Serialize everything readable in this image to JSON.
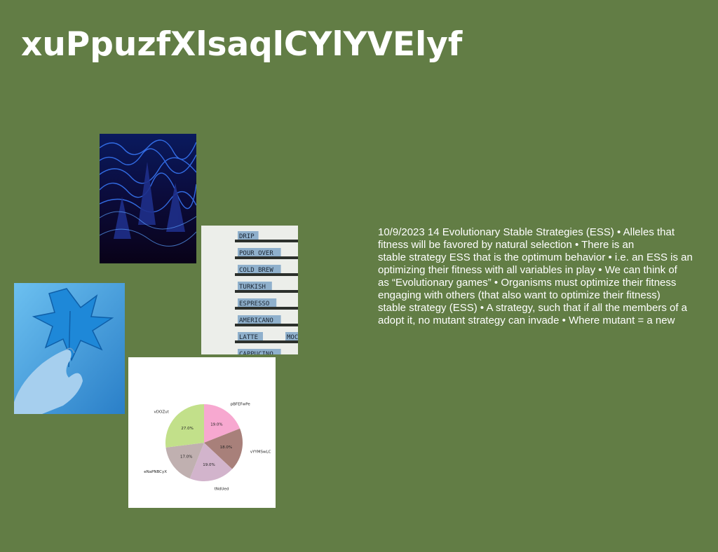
{
  "slide": {
    "title": "xuPpuzfXlsaqlCYlYVElyf",
    "background_color": "#627d45",
    "body_lines": [
      "10/9/2023 14 Evolutionary Stable Strategies (ESS) • Alleles that",
      "fitness will be favored by natural selection • There is an",
      "stable strategy ESS that is the optimum behavior • i.e. an ESS is an",
      "optimizing their fitness with all variables in play • We can think of",
      "as “Evolutionary games” • Organisms must optimize their fitness",
      "engaging with others (that also want to optimize their fitness)",
      "stable strategy (ESS) • A strategy, such that if all the members of a",
      "adopt it, no mutant strategy can invade • Where mutant =  a new"
    ]
  },
  "images": {
    "waves": "abstract blue glowing waves",
    "board": {
      "items": [
        "DRIP",
        "POUR OVER",
        "COLD BREW",
        "TURKISH",
        "ESPRESSO",
        "AMERICANO",
        "LATTE",
        "MOC",
        "CAPPUCINO"
      ]
    },
    "leaf": "hand holding blue leaf"
  },
  "chart_data": {
    "type": "pie",
    "slices": [
      {
        "label": "pBFEFwPe",
        "value": 19.0,
        "pct_label": "19.0%",
        "color": "#f7a8d0"
      },
      {
        "label": "vYYMSwLC",
        "value": 18.0,
        "pct_label": "18.0%",
        "color": "#a8807a"
      },
      {
        "label": "tNdUed",
        "value": 19.0,
        "pct_label": "19.0%",
        "color": "#d2b4cc"
      },
      {
        "label": "eNaPNBCyX",
        "value": 17.0,
        "pct_label": "17.0%",
        "color": "#c0b0b0"
      },
      {
        "label": "vDOZut",
        "value": 27.0,
        "pct_label": "27.0%",
        "color": "#c2e08a"
      }
    ]
  }
}
